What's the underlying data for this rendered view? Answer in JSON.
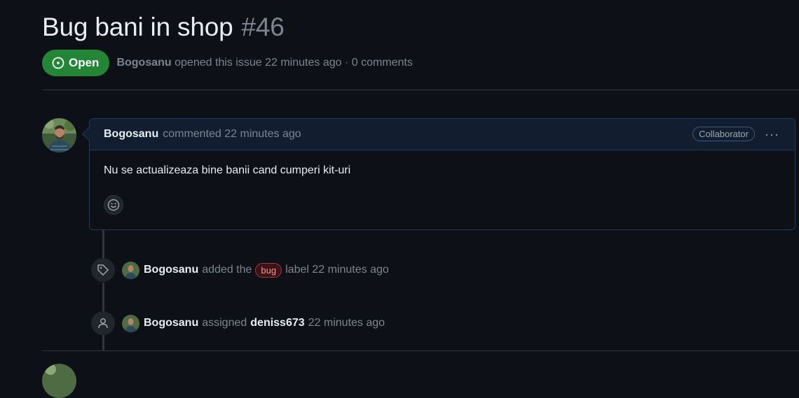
{
  "issue": {
    "title": "Bug bani in shop",
    "number": "#46",
    "state": "Open",
    "author": "Bogosanu",
    "meta_text": "opened this issue 22 minutes ago · 0 comments"
  },
  "comment": {
    "author": "Bogosanu",
    "action": "commented 22 minutes ago",
    "role_badge": "Collaborator",
    "menu_glyph": "···",
    "body": "Nu se actualizeaza bine banii cand cumperi kit-uri"
  },
  "events": [
    {
      "actor": "Bogosanu",
      "text_before": "added the",
      "label": "bug",
      "text_after": "label 22 minutes ago",
      "icon": "tag-icon"
    },
    {
      "actor": "Bogosanu",
      "text_before": "assigned",
      "assignee": "deniss673",
      "text_after": "22 minutes ago",
      "icon": "person-icon"
    }
  ],
  "colors": {
    "open_green": "#238636",
    "bug_label": "#a2383d",
    "background": "#0d1117"
  }
}
